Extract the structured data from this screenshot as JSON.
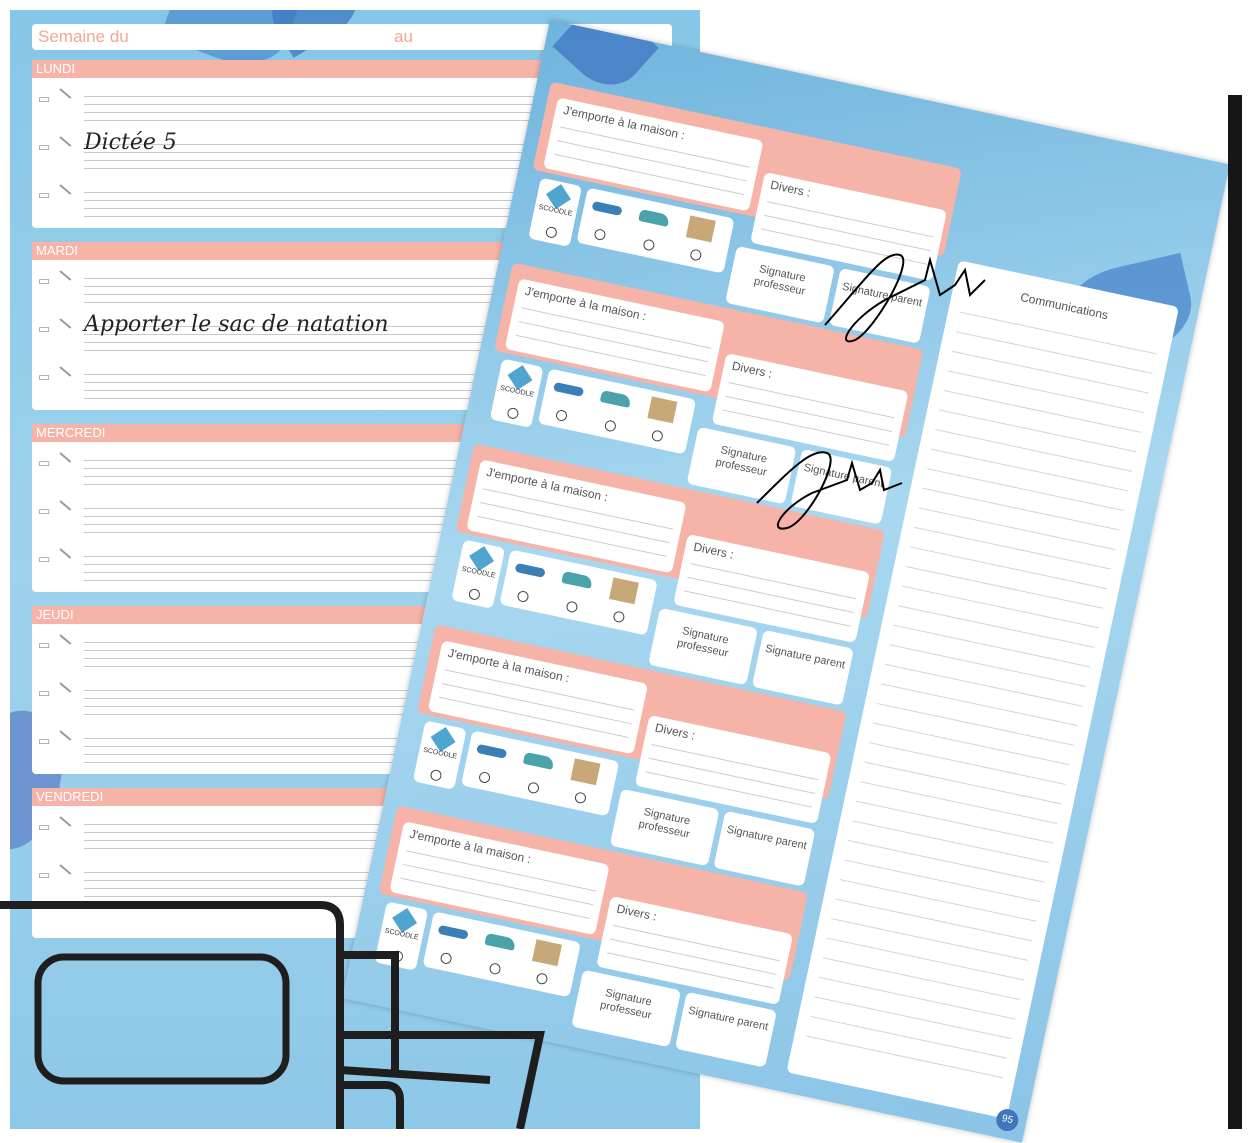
{
  "left_page": {
    "week_label": "Semaine du",
    "to_label": "au",
    "days": [
      {
        "name": "LUNDI",
        "entries": [
          "",
          "Dictée 5",
          ""
        ]
      },
      {
        "name": "MARDI",
        "entries": [
          "",
          "Apporter le sac de natation",
          ""
        ]
      },
      {
        "name": "MERCREDI",
        "entries": [
          "",
          "",
          ""
        ]
      },
      {
        "name": "JEUDI",
        "entries": [
          "",
          "",
          ""
        ]
      },
      {
        "name": "VENDREDI",
        "entries": [
          "",
          ""
        ]
      }
    ]
  },
  "right_page": {
    "blocks_count_label": "",
    "take_home_label": "J'emporte à la maison :",
    "misc_label": "Divers :",
    "signature_teacher_label": "Signature professeur",
    "signature_parent_label": "Signature parent",
    "scoodle_label": "SCOODLE",
    "communications_label": "Communications",
    "page_number": "95"
  },
  "colors": {
    "salmon": "#f6b3a8",
    "sky": "#8ec8e8",
    "ink": "#000000"
  },
  "icons": [
    "book-icon",
    "pencil-icon",
    "scoodle-logo-icon",
    "goggles-icon",
    "sneakers-icon",
    "envelope-icon",
    "signature-mark",
    "id-card-outline-icon"
  ]
}
